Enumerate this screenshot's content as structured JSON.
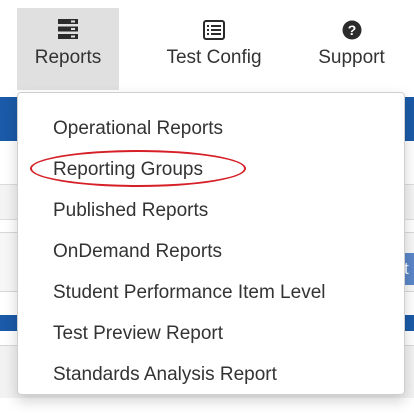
{
  "nav": {
    "items": [
      {
        "label": "Reports",
        "icon": "server-icon",
        "active": true
      },
      {
        "label": "Test Config",
        "icon": "list-icon",
        "active": false
      },
      {
        "label": "Support",
        "icon": "help-icon",
        "active": false
      }
    ]
  },
  "dropdown": {
    "items": [
      "Operational Reports",
      "Reporting Groups",
      "Published Reports",
      "OnDemand Reports",
      "Student Performance Item Level",
      "Test Preview Report",
      "Standards Analysis Report"
    ],
    "highlighted_index": 1
  },
  "background": {
    "partial_button_text": "t"
  },
  "colors": {
    "nav_active_bg": "#e0e0e0",
    "header_blue": "#1b5aa8",
    "highlight_oval": "#d61f26",
    "text": "#333333"
  }
}
